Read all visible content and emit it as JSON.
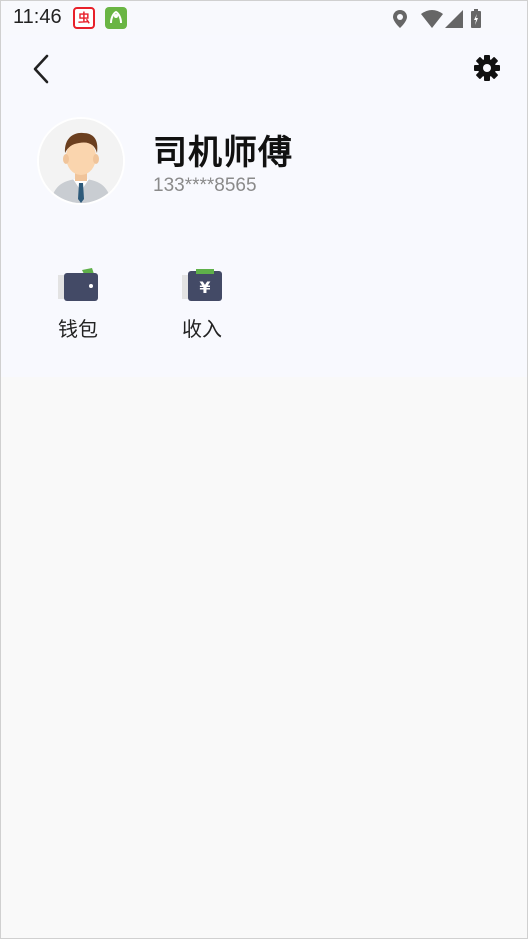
{
  "status_bar": {
    "time": "11:46",
    "app_icon_1": "虫"
  },
  "header": {
    "back_icon": "chevron-left-icon",
    "settings_icon": "gear-icon"
  },
  "profile": {
    "name": "司机师傅",
    "phone": "133****8565"
  },
  "menu": {
    "wallet_label": "钱包",
    "income_label": "收入",
    "income_symbol": "¥"
  },
  "colors": {
    "accent_green": "#6ab544",
    "icon_navy": "#434a66",
    "header_bg": "#f8f9fe",
    "page_bg": "#f9f9f9"
  }
}
